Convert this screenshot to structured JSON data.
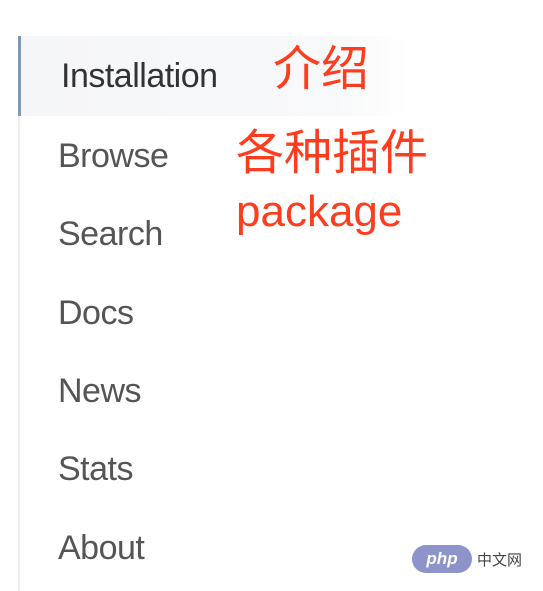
{
  "nav": {
    "items": [
      {
        "label": "Installation",
        "active": true
      },
      {
        "label": "Browse",
        "active": false
      },
      {
        "label": "Search",
        "active": false
      },
      {
        "label": "Docs",
        "active": false
      },
      {
        "label": "News",
        "active": false
      },
      {
        "label": "Stats",
        "active": false
      },
      {
        "label": "About",
        "active": false
      }
    ]
  },
  "annotations": {
    "line1": "介绍",
    "line2": "各种插件",
    "line3": "package"
  },
  "watermark": {
    "logo_text": "php",
    "site_text": "中文网"
  },
  "colors": {
    "annotation": "#ff3d1e",
    "active_border": "#7d97b4",
    "watermark_logo": "#8c94c9"
  }
}
